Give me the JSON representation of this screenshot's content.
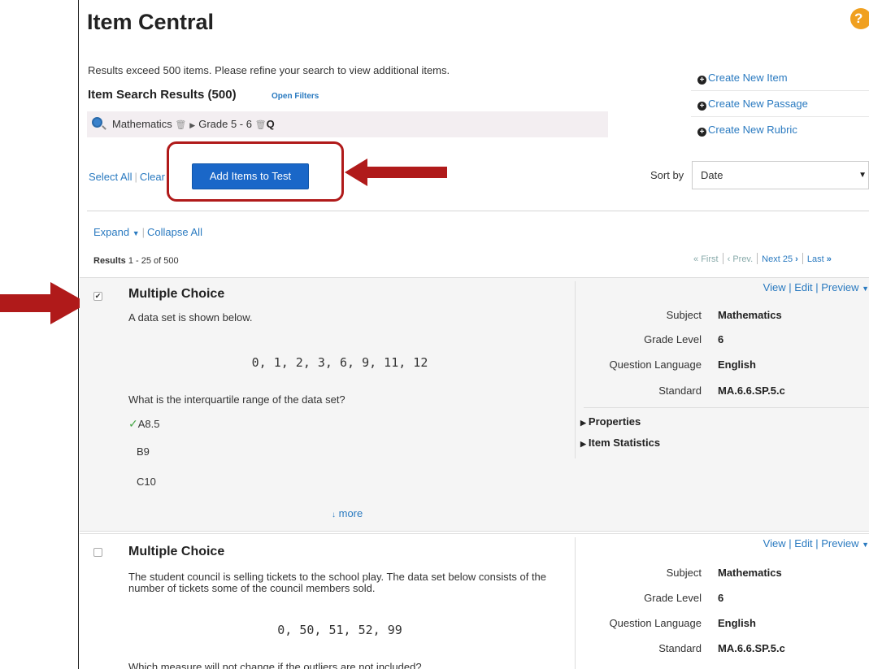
{
  "page": {
    "title": "Item Central",
    "help_label": "?"
  },
  "search": {
    "notice": "Results exceed 500 items. Please refine your search to view additional items.",
    "results_title": "Item Search Results (500)",
    "open_filters": "Open Filters",
    "filter_subject": "Mathematics",
    "filter_grade": "Grade 5 - 6"
  },
  "side_links": [
    {
      "label": "Create New Item"
    },
    {
      "label": "Create New Passage"
    },
    {
      "label": "Create New Rubric"
    }
  ],
  "toolbar": {
    "select_all": "Select All",
    "clear": "Clear",
    "add_items": "Add Items to Test",
    "sort_label": "Sort by",
    "sort_value": "Date"
  },
  "list_controls": {
    "expand": "Expand",
    "collapse_all": "Collapse All",
    "results_word": "Results",
    "results_range": "1 - 25 of 500",
    "pager_first": "First",
    "pager_prev": "Prev.",
    "pager_next": "Next 25",
    "pager_last": "Last"
  },
  "items": [
    {
      "checked": true,
      "type": "Multiple Choice",
      "stem": "A data set is shown below.",
      "dataset": "0, 1, 2, 3, 6, 9, 11, 12",
      "question": "What is the interquartile range of the data set?",
      "choices": [
        "A8.5",
        "B9",
        "C10"
      ],
      "more": "more",
      "actions": "View | Edit | Preview",
      "meta": [
        {
          "key": "Subject",
          "value": "Mathematics"
        },
        {
          "key": "Grade Level",
          "value": "6"
        },
        {
          "key": "Question Language",
          "value": "English"
        },
        {
          "key": "Standard",
          "value": "MA.6.6.SP.5.c"
        }
      ],
      "properties": "Properties",
      "item_statistics": "Item Statistics"
    },
    {
      "checked": false,
      "type": "Multiple Choice",
      "stem": "The student council is selling tickets to the school play. The data set below consists of the number of tickets some of the council members sold.",
      "dataset": "0, 50, 51, 52, 99",
      "question": "Which measure will not change if the outliers are not included?",
      "actions": "View | Edit | Preview",
      "meta": [
        {
          "key": "Subject",
          "value": "Mathematics"
        },
        {
          "key": "Grade Level",
          "value": "6"
        },
        {
          "key": "Question Language",
          "value": "English"
        },
        {
          "key": "Standard",
          "value": "MA.6.6.SP.5.c"
        }
      ]
    }
  ],
  "colors": {
    "link": "#2a7ac0",
    "primary_button": "#1a67c8",
    "annotation_red": "#b01a1a",
    "correct_check": "#4aa84a"
  }
}
